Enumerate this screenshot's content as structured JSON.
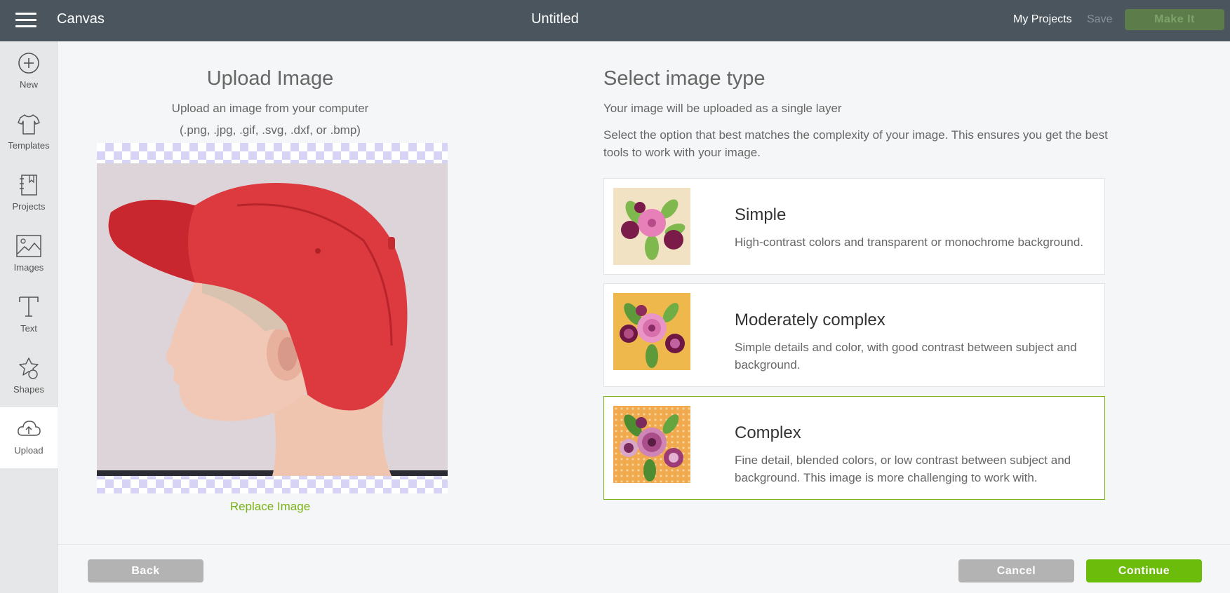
{
  "topbar": {
    "app_title": "Canvas",
    "document_title": "Untitled",
    "my_projects": "My Projects",
    "save": "Save",
    "make_it": "Make It"
  },
  "sidebar": {
    "items": [
      {
        "label": "New",
        "icon": "plus-circle-icon"
      },
      {
        "label": "Templates",
        "icon": "tshirt-icon"
      },
      {
        "label": "Projects",
        "icon": "notebook-icon"
      },
      {
        "label": "Images",
        "icon": "image-icon"
      },
      {
        "label": "Text",
        "icon": "text-icon"
      },
      {
        "label": "Shapes",
        "icon": "shapes-icon"
      },
      {
        "label": "Upload",
        "icon": "cloud-upload-icon",
        "active": true
      }
    ]
  },
  "upload": {
    "title": "Upload Image",
    "subtitle": "Upload an image from your computer",
    "formats": "(.png, .jpg, .gif, .svg, .dxf, or .bmp)",
    "replace": "Replace Image"
  },
  "image_type": {
    "title": "Select image type",
    "subtitle": "Your image will be uploaded as a single layer",
    "description": "Select the option that best matches the complexity of your image. This ensures you get the best tools to work with your image.",
    "options": [
      {
        "name": "Simple",
        "detail": "High-contrast colors and transparent or monochrome background."
      },
      {
        "name": "Moderately complex",
        "detail": "Simple details and color, with good contrast between subject and background."
      },
      {
        "name": "Complex",
        "detail": "Fine detail, blended colors, or low contrast between subject and background. This image is more challenging to work with.",
        "selected": true
      }
    ]
  },
  "buttons": {
    "back": "Back",
    "cancel": "Cancel",
    "continue": "Continue"
  },
  "colors": {
    "topbar": "#4a555d",
    "accent_green": "#7ab317",
    "continue_green": "#6cbc0c",
    "make_it_disabled": "#5c7d4a"
  }
}
